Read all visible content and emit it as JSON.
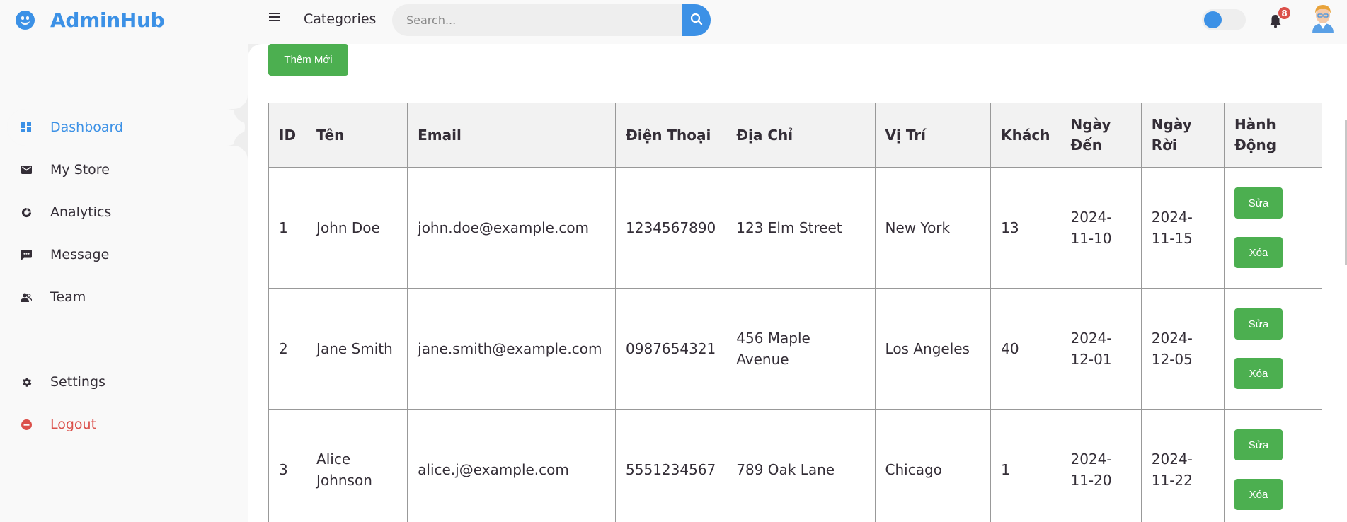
{
  "brand": {
    "name": "AdminHub"
  },
  "sidebar": {
    "items": [
      {
        "label": "Dashboard",
        "icon": "dashboard-icon",
        "active": true
      },
      {
        "label": "My Store",
        "icon": "store-icon"
      },
      {
        "label": "Analytics",
        "icon": "analytics-icon"
      },
      {
        "label": "Message",
        "icon": "message-icon"
      },
      {
        "label": "Team",
        "icon": "team-icon"
      }
    ],
    "bottom": [
      {
        "label": "Settings",
        "icon": "gear-icon"
      },
      {
        "label": "Logout",
        "icon": "logout-icon"
      }
    ]
  },
  "navbar": {
    "categories_label": "Categories",
    "search_placeholder": "Search...",
    "notification_count": "8"
  },
  "main": {
    "add_button": "Thêm Mới",
    "table": {
      "headers": [
        "ID",
        "Tên",
        "Email",
        "Điện Thoại",
        "Địa Chỉ",
        "Vị Trí",
        "Khách",
        "Ngày Đến",
        "Ngày Rời",
        "Hành Động"
      ],
      "rows": [
        {
          "id": "1",
          "name": "John Doe",
          "email": "john.doe@example.com",
          "phone": "1234567890",
          "address": "123 Elm Street",
          "location": "New York",
          "guests": "13",
          "arrival": "2024-11-10",
          "departure": "2024-11-15"
        },
        {
          "id": "2",
          "name": "Jane Smith",
          "email": "jane.smith@example.com",
          "phone": "0987654321",
          "address": "456 Maple Avenue",
          "location": "Los Angeles",
          "guests": "40",
          "arrival": "2024-12-01",
          "departure": "2024-12-05"
        },
        {
          "id": "3",
          "name": "Alice Johnson",
          "email": "alice.j@example.com",
          "phone": "5551234567",
          "address": "789 Oak Lane",
          "location": "Chicago",
          "guests": "1",
          "arrival": "2024-11-20",
          "departure": "2024-11-22"
        }
      ],
      "edit_label": "Sửa",
      "delete_label": "Xóa"
    }
  },
  "colors": {
    "accent": "#3c91e6",
    "success": "#4caf50",
    "danger": "#db504a"
  }
}
